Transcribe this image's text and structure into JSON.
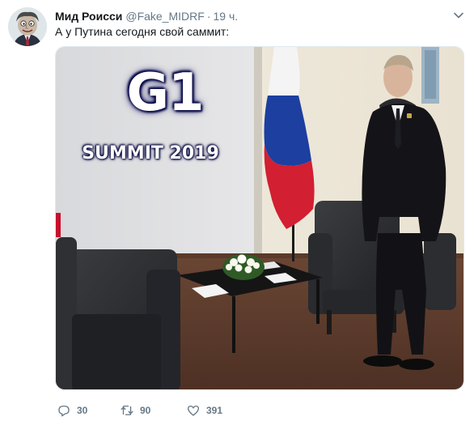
{
  "tweet": {
    "author_name": "Мид Роисси",
    "handle": "@Fake_MIDRF",
    "separator": "·",
    "time": "19 ч.",
    "text": "А у Путина сегодня свой саммит:",
    "avatar_icon": "cartoon-avatar",
    "menu_icon": "chevron-down-icon"
  },
  "media": {
    "title": "G1",
    "subtitle": "SUMMIT 2019"
  },
  "actions": {
    "reply_count": "30",
    "retweet_count": "90",
    "like_count": "391"
  },
  "colors": {
    "text_primary": "#14171a",
    "text_secondary": "#657786",
    "border": "#e1e8ed"
  }
}
